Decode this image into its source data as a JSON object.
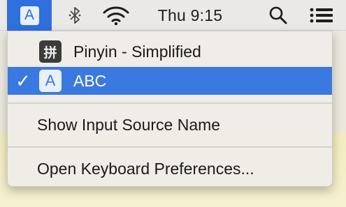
{
  "menubar": {
    "input_source_badge": "A",
    "icons": [
      "input-source-icon",
      "bluetooth-icon",
      "wifi-icon",
      "search-icon",
      "list-icon"
    ],
    "clock": "Thu 9:15"
  },
  "menu": {
    "items": [
      {
        "label": "Pinyin - Simplified",
        "icon_text": "拼",
        "checked": false,
        "selected": false
      },
      {
        "label": "ABC",
        "icon_text": "A",
        "checked": true,
        "selected": true,
        "check_mark": "✓"
      },
      {
        "label": "Show Input Source Name"
      },
      {
        "label": "Open Keyboard Preferences..."
      }
    ]
  },
  "colors": {
    "highlight": "#3a79e0",
    "menubar": "#ebe9e7",
    "menu_bg": "#f0ede8"
  }
}
